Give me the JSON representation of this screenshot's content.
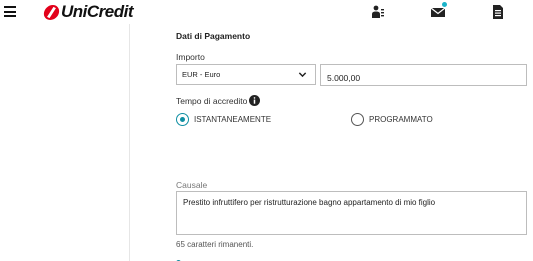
{
  "header": {
    "brand": "UniCredit",
    "icons": [
      "menu-icon",
      "profile-icon",
      "mail-icon",
      "document-icon"
    ],
    "brand_color": "#e2001a",
    "notification_color": "#1ab3c9"
  },
  "form": {
    "section_title": "Dati di Pagamento",
    "importo_label": "Importo",
    "currency_selected": "EUR - Euro",
    "amount_value": "5.000,00",
    "tempo_label": "Tempo di accredito",
    "options": [
      {
        "label": "ISTANTANEAMENTE",
        "selected": true
      },
      {
        "label": "PROGRAMMATO",
        "selected": false
      }
    ],
    "causale_label": "Causale",
    "causale_value": "Prestito infruttifero per ristrutturazione bagno appartamento di mio figlio",
    "remaining": "65 caratteri rimanenti.",
    "accent_color": "#0f8fa3"
  }
}
